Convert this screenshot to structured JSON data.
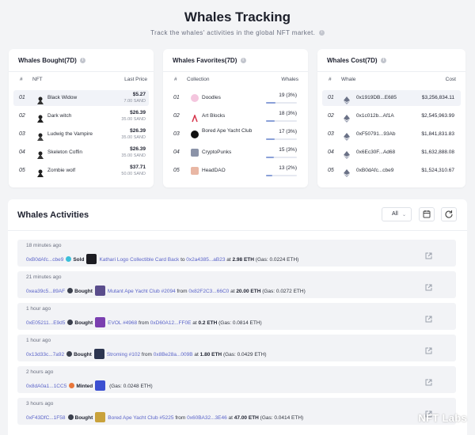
{
  "header": {
    "title": "Whales Tracking",
    "subtitle": "Track the whales' activities in the global NFT market."
  },
  "bought": {
    "title": "Whales Bought(7D)",
    "cols": [
      "#",
      "NFT",
      "Last Price"
    ],
    "rows": [
      {
        "rank": "01",
        "name": "Black Widow",
        "price": "$5.27",
        "sand": "7.00 SAND"
      },
      {
        "rank": "02",
        "name": "Dark witch",
        "price": "$26.39",
        "sand": "35.00 SAND"
      },
      {
        "rank": "03",
        "name": "Ludwig the Vampire",
        "price": "$26.39",
        "sand": "35.00 SAND"
      },
      {
        "rank": "04",
        "name": "Skeleton Coffin",
        "price": "$26.39",
        "sand": "35.00 SAND"
      },
      {
        "rank": "05",
        "name": "Zombie wolf",
        "price": "$37.71",
        "sand": "50.00 SAND"
      }
    ]
  },
  "favorites": {
    "title": "Whales Favorites(7D)",
    "cols": [
      "#",
      "Collection",
      "Whales"
    ],
    "rows": [
      {
        "rank": "01",
        "name": "Doodles",
        "value": "19 (3%)",
        "fill": 0.3
      },
      {
        "rank": "02",
        "name": "Art Blocks",
        "value": "18 (3%)",
        "fill": 0.29
      },
      {
        "rank": "03",
        "name": "Bored Ape Yacht Club",
        "value": "17 (3%)",
        "fill": 0.28
      },
      {
        "rank": "04",
        "name": "CryptoPunks",
        "value": "15 (3%)",
        "fill": 0.26
      },
      {
        "rank": "05",
        "name": "HeadDAO",
        "value": "13 (2%)",
        "fill": 0.2
      }
    ]
  },
  "cost": {
    "title": "Whales Cost(7D)",
    "cols": [
      "#",
      "Whale",
      "Cost"
    ],
    "rows": [
      {
        "rank": "01",
        "addr": "0x1919DB...E685",
        "cost": "$3,256,834.11"
      },
      {
        "rank": "02",
        "addr": "0x1c012b...Af1A",
        "cost": "$2,545,963.99"
      },
      {
        "rank": "03",
        "addr": "0xF50791...93Ab",
        "cost": "$1,841,831.83"
      },
      {
        "rank": "04",
        "addr": "0x6Ec30F...Ad68",
        "cost": "$1,632,888.08"
      },
      {
        "rank": "05",
        "addr": "0xB0dAfc...cbe9",
        "cost": "$1,524,310.67"
      }
    ]
  },
  "activities": {
    "title": "Whales Activities",
    "filter": "All",
    "items": [
      {
        "ago": "18 minutes ago",
        "from": "0xB0dAfc...cbe9",
        "action": "Sold",
        "nft": "Kathari Logo Collectible Card Back",
        "dir": "to",
        "counter": "0x2a4385...aB23",
        "at": "at",
        "amount": "2.98 ETH",
        "gas": "(Gas: 0.0224 ETH)"
      },
      {
        "ago": "21 minutes ago",
        "from": "0xea39c5...89AF",
        "action": "Bought",
        "nft": "Mutant Ape Yacht Club #2094",
        "dir": "from",
        "counter": "0x82F2C3...66C0",
        "at": "at",
        "amount": "20.00 ETH",
        "gas": "(Gas: 0.0272 ETH)"
      },
      {
        "ago": "1 hour ago",
        "from": "0xE05211...E9d5",
        "action": "Bought",
        "nft": "EVOL #4968",
        "dir": "from",
        "counter": "0xD60A12...FF0E",
        "at": "at",
        "amount": "0.2 ETH",
        "gas": "(Gas: 0.0814 ETH)"
      },
      {
        "ago": "1 hour ago",
        "from": "0x13d33c...7a92",
        "action": "Bought",
        "nft": "Stroming #102",
        "dir": "from",
        "counter": "0x8Be28a...009B",
        "at": "at",
        "amount": "1.80 ETH",
        "gas": "(Gas: 0.0429 ETH)"
      },
      {
        "ago": "2 hours ago",
        "from": "0x8dA0a1...1CC5",
        "action": "Minted",
        "nft": "",
        "dir": "",
        "counter": "",
        "at": "",
        "amount": "",
        "gas": "(Gas: 0.0248 ETH)"
      },
      {
        "ago": "3 hours ago",
        "from": "0xF43DfC...1F58",
        "action": "Bought",
        "nft": "Bored Ape Yacht Club #5225",
        "dir": "from",
        "counter": "0x60BA32...3E46",
        "at": "at",
        "amount": "47.00 ETH",
        "gas": "(Gas: 0.0414 ETH)"
      }
    ]
  },
  "watermark": "NFT Labs",
  "colors": {
    "accent": "#5b64c9",
    "bar": "#8aa0d8",
    "background": "#f3f4f6"
  }
}
